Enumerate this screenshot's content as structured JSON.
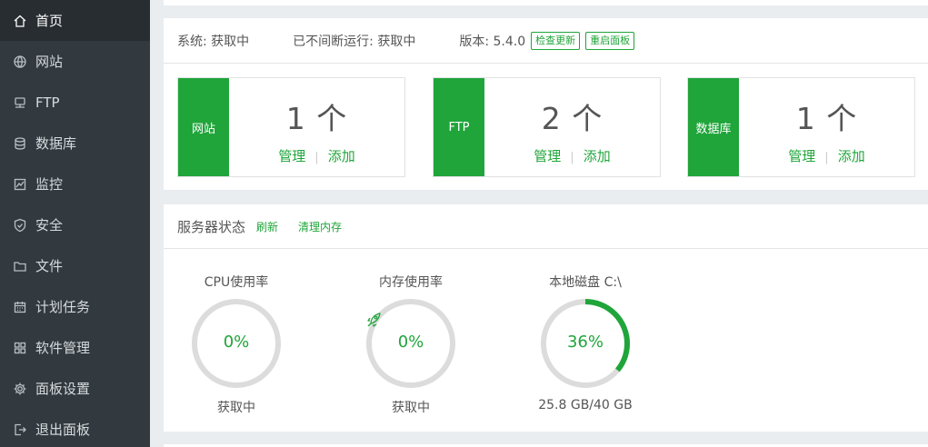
{
  "sidebar": {
    "items": [
      {
        "label": "首页",
        "icon": "home-icon",
        "active": true
      },
      {
        "label": "网站",
        "icon": "globe-icon"
      },
      {
        "label": "FTP",
        "icon": "ftp-icon"
      },
      {
        "label": "数据库",
        "icon": "database-icon"
      },
      {
        "label": "监控",
        "icon": "monitor-icon"
      },
      {
        "label": "安全",
        "icon": "shield-icon"
      },
      {
        "label": "文件",
        "icon": "folder-icon"
      },
      {
        "label": "计划任务",
        "icon": "calendar-icon"
      },
      {
        "label": "软件管理",
        "icon": "apps-icon"
      },
      {
        "label": "面板设置",
        "icon": "gear-icon"
      },
      {
        "label": "退出面板",
        "icon": "logout-icon"
      }
    ]
  },
  "status": {
    "system": "系统: 获取中",
    "uptime": "已不间断运行: 获取中",
    "version": "版本: 5.4.0",
    "check_update": "检查更新",
    "restart_panel": "重启面板"
  },
  "cards": [
    {
      "label": "网站",
      "count": "1 个",
      "manage": "管理",
      "add": "添加"
    },
    {
      "label": "FTP",
      "count": "2 个",
      "manage": "管理",
      "add": "添加"
    },
    {
      "label": "数据库",
      "count": "1 个",
      "manage": "管理",
      "add": "添加"
    }
  ],
  "server": {
    "title": "服务器状态",
    "refresh": "刷新",
    "clear_memory": "清理内存",
    "gauges": [
      {
        "title": "CPU使用率",
        "value": "0%",
        "fraction": 0,
        "footer": "获取中"
      },
      {
        "title": "内存使用率",
        "value": "0%",
        "fraction": 0,
        "footer": "获取中"
      },
      {
        "title": "本地磁盘 C:\\",
        "value": "36%",
        "fraction": 0.36,
        "footer": "25.8 GB/40 GB"
      }
    ]
  },
  "colors": {
    "accent": "#20a53a",
    "sidebar_bg": "#323a40",
    "sidebar_active": "#272d31",
    "ring_track": "#dcdcdc"
  }
}
